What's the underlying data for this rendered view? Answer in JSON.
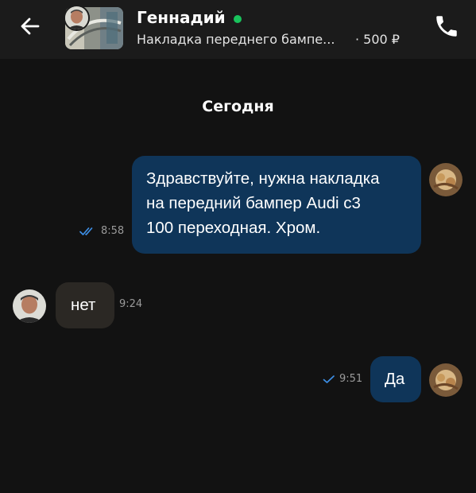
{
  "header": {
    "contact_name": "Геннадий",
    "ad_title": "Накладка переднего бампе...",
    "ad_price": "· 500 ₽",
    "online_color": "#19c35c",
    "back_icon": "arrow-left-icon",
    "call_icon": "phone-icon"
  },
  "chat": {
    "date_separator": "Сегодня",
    "messages": [
      {
        "direction": "outgoing",
        "text": "Здравствуйте, нужна накладка\nна передний бампер Audi c3\n100 переходная. Хром.",
        "time": "8:58",
        "status": "read",
        "status_icon": "double-check-icon"
      },
      {
        "direction": "incoming",
        "text": "нет",
        "time": "9:24"
      },
      {
        "direction": "outgoing",
        "text": "Да",
        "time": "9:51",
        "status": "sent",
        "status_icon": "check-icon"
      }
    ]
  },
  "colors": {
    "background": "#121212",
    "header_background": "#1b1b1b",
    "outgoing_bubble": "#0f3559",
    "incoming_bubble": "#2b2824",
    "check_color": "#3d8fe6"
  }
}
